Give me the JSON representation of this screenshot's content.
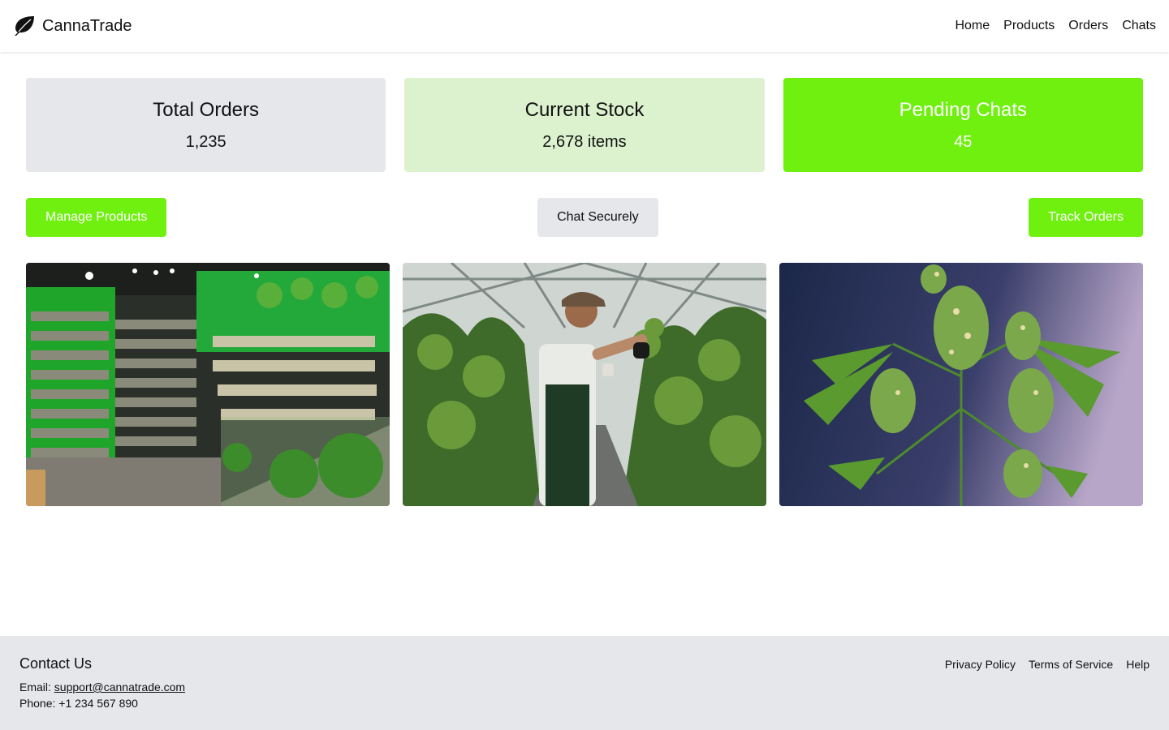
{
  "header": {
    "brand": "CannaTrade",
    "logo_icon": "leaf-icon",
    "nav": [
      "Home",
      "Products",
      "Orders",
      "Chats"
    ]
  },
  "stats": [
    {
      "title": "Total Orders",
      "value": "1,235"
    },
    {
      "title": "Current Stock",
      "value": "2,678 items"
    },
    {
      "title": "Pending Chats",
      "value": "45"
    }
  ],
  "actions": {
    "manage_products": "Manage Products",
    "chat_securely": "Chat Securely",
    "track_orders": "Track Orders"
  },
  "gallery": [
    {
      "icon": "dispensary-photo"
    },
    {
      "icon": "greenhouse-worker-photo"
    },
    {
      "icon": "cannabis-plant-photo"
    }
  ],
  "footer": {
    "contact_title": "Contact Us",
    "email_label": "Email:",
    "email": "support@cannatrade.com",
    "phone": "Phone: +1 234 567 890",
    "links": [
      "Privacy Policy",
      "Terms of Service",
      "Help"
    ]
  },
  "colors": {
    "accent": "#6ff00f",
    "light_green": "#dcf2cf",
    "gray": "#e5e7eb"
  }
}
